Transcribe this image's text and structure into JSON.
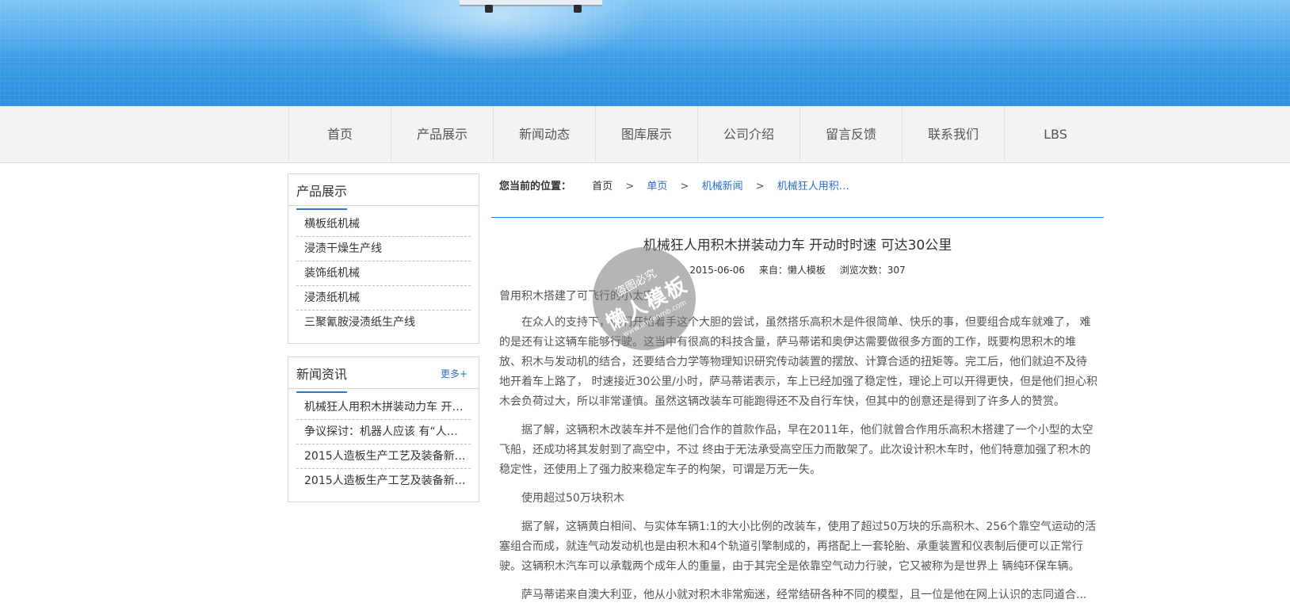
{
  "nav": {
    "items": [
      "首页",
      "产品展示",
      "新闻动态",
      "图库展示",
      "公司介绍",
      "留言反馈",
      "联系我们",
      "LBS"
    ]
  },
  "sidebar": {
    "products": {
      "title": "产品展示",
      "items": [
        "横板纸机械",
        "浸渍干燥生产线",
        "装饰纸机械",
        "浸渍纸机械",
        "三聚氰胺浸渍纸生产线"
      ]
    },
    "news": {
      "title": "新闻资讯",
      "more": "更多+",
      "items": [
        "机械狂人用积木拼装动力车 开…",
        "争议探讨：机器人应该 有“人…",
        "2015人造板生产工艺及装备新技…",
        "2015人造板生产工艺及装备新技…"
      ]
    }
  },
  "breadcrumb": {
    "label": "您当前的位置：",
    "items": [
      "首页",
      "单页",
      "机械新闻",
      "机械狂人用积…"
    ],
    "separator": ">"
  },
  "article": {
    "title": "机械狂人用积木拼装动力车 开动时时速 可达30公里",
    "date": "2015-06-06",
    "source": "来自：懒人模板",
    "views": "浏览次数：307",
    "paragraphs": [
      "曾用积木搭建了可飞行的小太空",
      "在众人的支持下，他们开始着手这个大胆的尝试，虽然搭乐高积木是件很简单、快乐的事，但要组合成车就难了，  难的是还有让这辆车能够行驶。这当中有很高的科技含量，萨马蒂诺和奥伊达需要做很多方面的工作，既要构思积木的堆放、积木与发动机的结合，还要结合力学等物理知识研究传动装置的摆放、计算合适的扭矩等。完工后，他们就迫不及待地开着车上路了，  时速接近30公里/小时，萨马蒂诺表示，车上已经加强了稳定性，理论上可以开得更快，但是他们担心积木会负荷过大，所以非常谨慎。虽然这辆改装车可能跑得还不及自行车快，但其中的创意还是得到了许多人的赞赏。",
      "据了解，这辆积木改装车并不是他们合作的首款作品，早在2011年，他们就曾合作用乐高积木搭建了一个小型的太空飞船，还成功将其发射到了高空中，不过  终由于无法承受高空压力而散架了。此次设计积木车时，他们特意加强了积木的稳定性，还使用上了强力胶来稳定车子的构架，可谓是万无一失。",
      "使用超过50万块积木",
      "据了解，这辆黄白相间、与实体车辆1:1的大小比例的改装车，使用了超过50万块的乐高积木、256个靠空气运动的活塞组合而成，就连气动发动机也是由积木和4个轨道引擎制成的，再搭配上一套轮胎、承重装置和仪表制后便可以正常行驶。这辆积木汽车可以承载两个成年人的重量，由于其完全是依靠空气动力行驶，它又被称为是世界上  辆纯环保车辆。",
      "萨马蒂诺来自澳大利亚，他从小就对积木非常痴迷，经常结研各种不同的模型，且一位是他在网上认识的志同道合..."
    ]
  },
  "watermark": {
    "line1": "盗图必究",
    "line2": "懒人模板",
    "line3": "www.lanrenmb.com"
  }
}
